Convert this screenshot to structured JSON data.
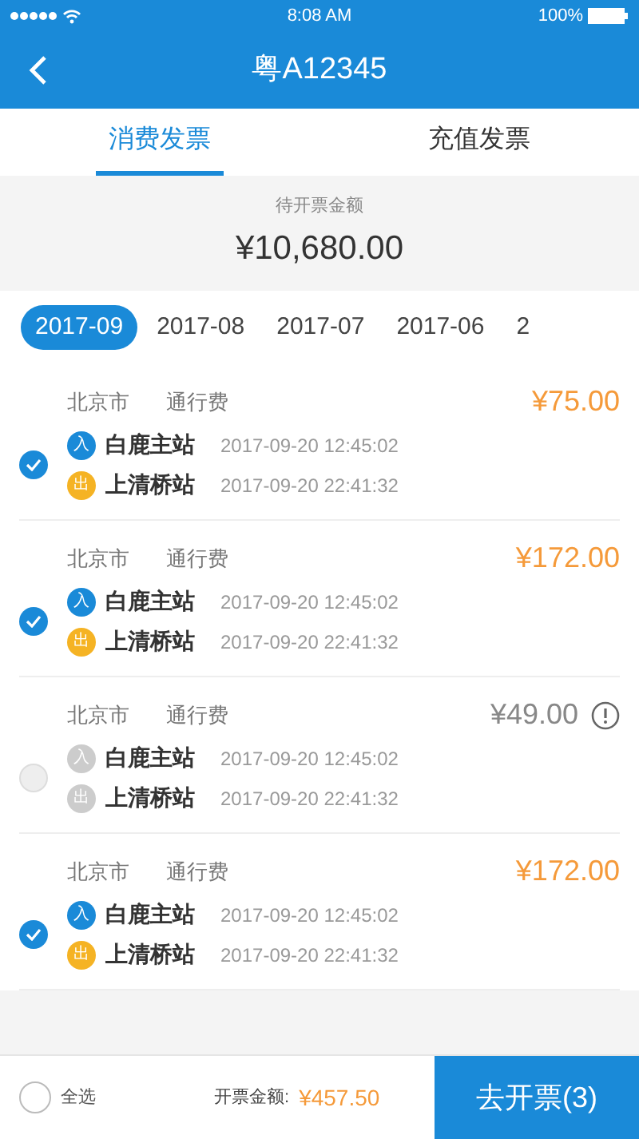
{
  "status_bar": {
    "time": "8:08 AM",
    "battery": "100%"
  },
  "header": {
    "title": "粤A12345"
  },
  "tabs": [
    {
      "label": "消费发票",
      "selected": true
    },
    {
      "label": "充值发票",
      "selected": false
    }
  ],
  "summary": {
    "label": "待开票金额",
    "amount": "¥10,680.00"
  },
  "months": [
    {
      "label": "2017-09",
      "selected": true
    },
    {
      "label": "2017-08",
      "selected": false
    },
    {
      "label": "2017-07",
      "selected": false
    },
    {
      "label": "2017-06",
      "selected": false
    },
    {
      "label": "2",
      "selected": false
    }
  ],
  "records": [
    {
      "city": "北京市",
      "type": "通行费",
      "amount": "¥75.00",
      "checked": true,
      "disabled": false,
      "warning": false,
      "entry": {
        "badge": "入",
        "station": "白鹿主站",
        "time": "2017-09-20 12:45:02"
      },
      "exit": {
        "badge": "出",
        "station": "上清桥站",
        "time": "2017-09-20 22:41:32"
      }
    },
    {
      "city": "北京市",
      "type": "通行费",
      "amount": "¥172.00",
      "checked": true,
      "disabled": false,
      "warning": false,
      "entry": {
        "badge": "入",
        "station": "白鹿主站",
        "time": "2017-09-20 12:45:02"
      },
      "exit": {
        "badge": "出",
        "station": "上清桥站",
        "time": "2017-09-20 22:41:32"
      }
    },
    {
      "city": "北京市",
      "type": "通行费",
      "amount": "¥49.00",
      "checked": false,
      "disabled": true,
      "warning": true,
      "entry": {
        "badge": "入",
        "station": "白鹿主站",
        "time": "2017-09-20 12:45:02"
      },
      "exit": {
        "badge": "出",
        "station": "上清桥站",
        "time": "2017-09-20 22:41:32"
      }
    },
    {
      "city": "北京市",
      "type": "通行费",
      "amount": "¥172.00",
      "checked": true,
      "disabled": false,
      "warning": false,
      "entry": {
        "badge": "入",
        "station": "白鹿主站",
        "time": "2017-09-20 12:45:02"
      },
      "exit": {
        "badge": "出",
        "station": "上清桥站",
        "time": "2017-09-20 22:41:32"
      }
    }
  ],
  "footer": {
    "select_all": {
      "label": "全选",
      "checked": false
    },
    "total_label": "开票金额:",
    "total": "¥457.50",
    "button": "去开票(3)"
  }
}
